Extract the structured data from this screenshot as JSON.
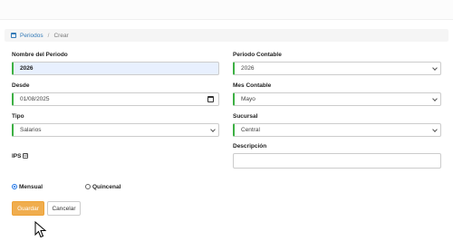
{
  "breadcrumb": {
    "link": "Periodos",
    "separator": "/",
    "current": "Crear"
  },
  "form": {
    "nombre": {
      "label": "Nombre del Periodo",
      "value": "2026"
    },
    "periodo_contable": {
      "label": "Periodo Contable",
      "value": "2026"
    },
    "desde": {
      "label": "Desde",
      "value": "01/08/2025"
    },
    "mes_contable": {
      "label": "Mes Contable",
      "value": "Mayo"
    },
    "tipo": {
      "label": "Tipo",
      "value": "Salarios"
    },
    "sucursal": {
      "label": "Sucursal",
      "value": "Central"
    },
    "ips": {
      "label": "IPS",
      "check": "☑"
    },
    "descripcion": {
      "label": "Descripción",
      "value": ""
    },
    "mensual": {
      "label": "Mensual"
    },
    "quincenal": {
      "label": "Quincenal"
    }
  },
  "buttons": {
    "save": "Guardar",
    "cancel": "Cancelar"
  }
}
